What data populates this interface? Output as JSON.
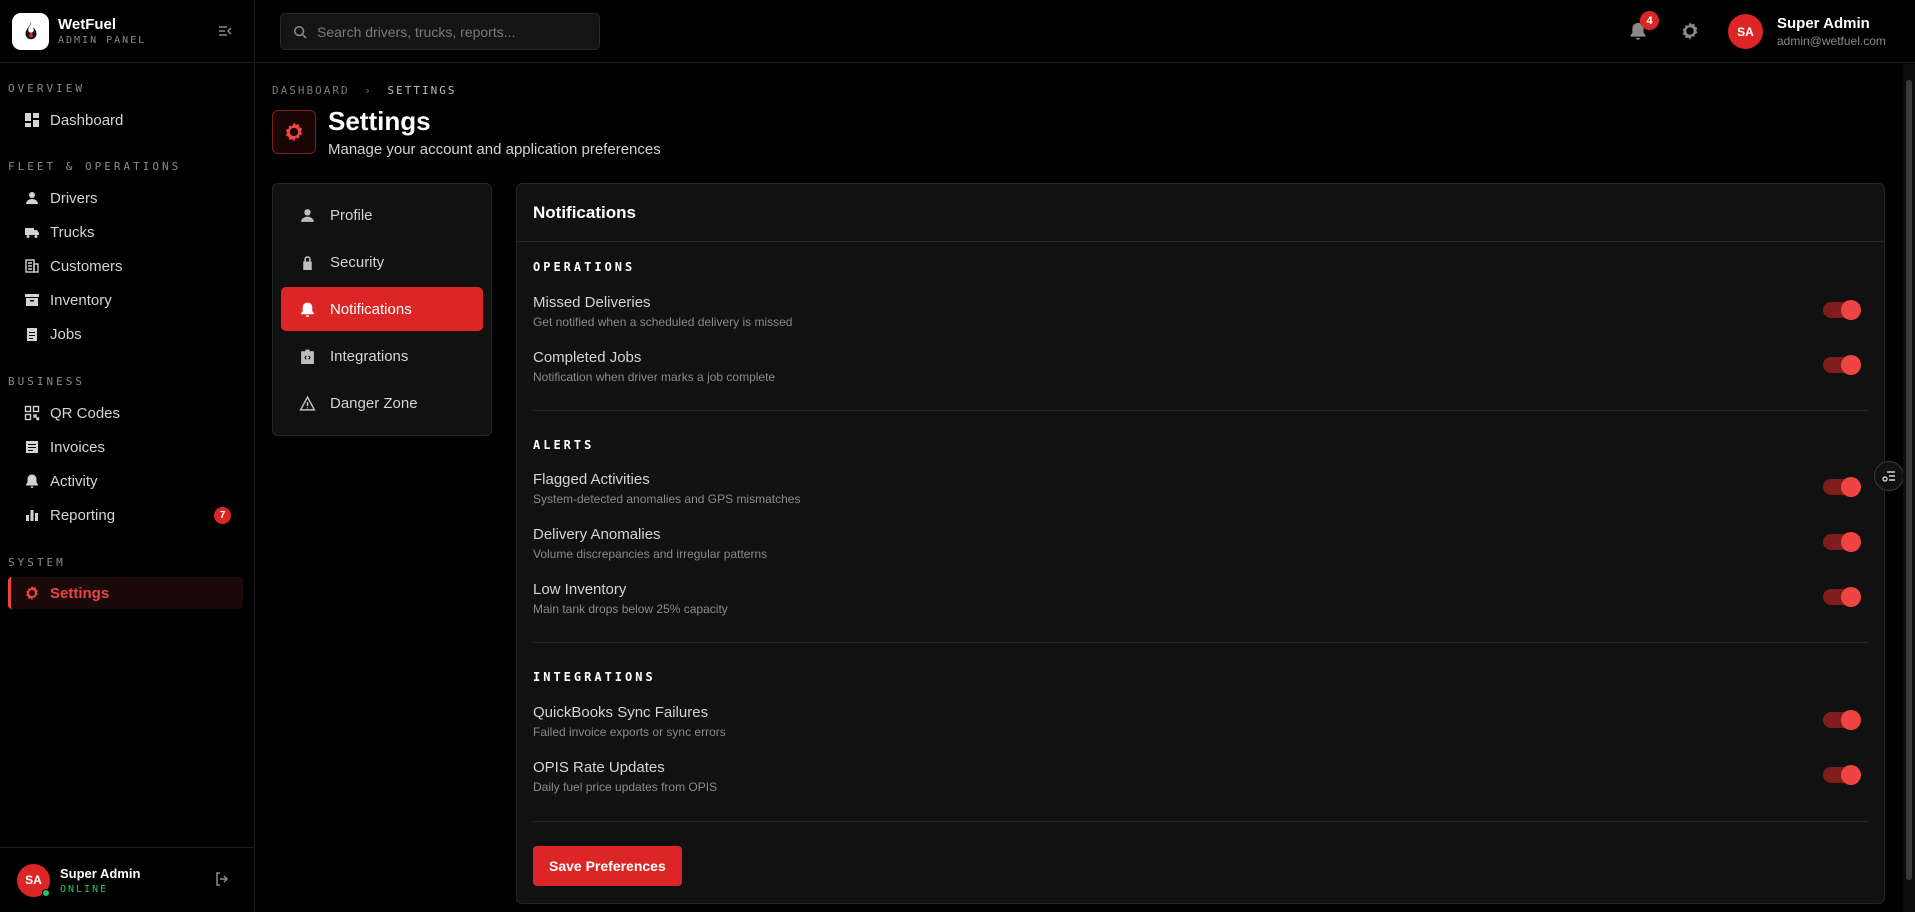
{
  "brand": {
    "title": "WetFuel",
    "subtitle": "ADMIN PANEL"
  },
  "sidebar": {
    "sections": [
      {
        "label": "OVERVIEW"
      },
      {
        "label": "FLEET & OPERATIONS"
      },
      {
        "label": "BUSINESS"
      },
      {
        "label": "SYSTEM"
      }
    ],
    "items": [
      {
        "label": "Dashboard",
        "icon": "dashboard-icon"
      },
      {
        "label": "Drivers",
        "icon": "person-icon"
      },
      {
        "label": "Trucks",
        "icon": "truck-icon"
      },
      {
        "label": "Customers",
        "icon": "building-icon"
      },
      {
        "label": "Inventory",
        "icon": "archive-icon"
      },
      {
        "label": "Jobs",
        "icon": "clipboard-icon"
      },
      {
        "label": "QR Codes",
        "icon": "qr-icon"
      },
      {
        "label": "Invoices",
        "icon": "invoice-icon"
      },
      {
        "label": "Activity",
        "icon": "bell-icon"
      },
      {
        "label": "Reporting",
        "icon": "bar-chart-icon",
        "badge": "7"
      },
      {
        "label": "Settings",
        "icon": "gear-icon",
        "active": true
      }
    ],
    "footer": {
      "initials": "SA",
      "name": "Super Admin",
      "status": "ONLINE"
    }
  },
  "topbar": {
    "search_placeholder": "Search drivers, trucks, reports...",
    "notification_count": "4",
    "user": {
      "initials": "SA",
      "name": "Super Admin",
      "email": "admin@wetfuel.com"
    }
  },
  "breadcrumb": {
    "root": "DASHBOARD",
    "separator": "›",
    "current": "SETTINGS"
  },
  "page": {
    "title": "Settings",
    "subtitle": "Manage your account and application preferences"
  },
  "settings_nav": [
    {
      "label": "Profile",
      "icon": "person-icon"
    },
    {
      "label": "Security",
      "icon": "lock-icon"
    },
    {
      "label": "Notifications",
      "icon": "bell-icon",
      "active": true
    },
    {
      "label": "Integrations",
      "icon": "integration-icon"
    },
    {
      "label": "Danger Zone",
      "icon": "warning-icon"
    }
  ],
  "panel": {
    "title": "Notifications",
    "groups": [
      {
        "title": "OPERATIONS",
        "rows": [
          {
            "title": "Missed Deliveries",
            "desc": "Get notified when a scheduled delivery is missed",
            "enabled": true
          },
          {
            "title": "Completed Jobs",
            "desc": "Notification when driver marks a job complete",
            "enabled": true
          }
        ]
      },
      {
        "title": "ALERTS",
        "rows": [
          {
            "title": "Flagged Activities",
            "desc": "System-detected anomalies and GPS mismatches",
            "enabled": true
          },
          {
            "title": "Delivery Anomalies",
            "desc": "Volume discrepancies and irregular patterns",
            "enabled": true
          },
          {
            "title": "Low Inventory",
            "desc": "Main tank drops below 25% capacity",
            "enabled": true
          }
        ]
      },
      {
        "title": "INTEGRATIONS",
        "rows": [
          {
            "title": "QuickBooks Sync Failures",
            "desc": "Failed invoice exports or sync errors",
            "enabled": true
          },
          {
            "title": "OPIS Rate Updates",
            "desc": "Daily fuel price updates from OPIS",
            "enabled": true
          }
        ]
      }
    ],
    "save_label": "Save Preferences"
  },
  "colors": {
    "accent": "#dc2626",
    "accent_bright": "#ef4444",
    "online": "#22c55e",
    "background": "#000000",
    "panel": "#111111"
  }
}
